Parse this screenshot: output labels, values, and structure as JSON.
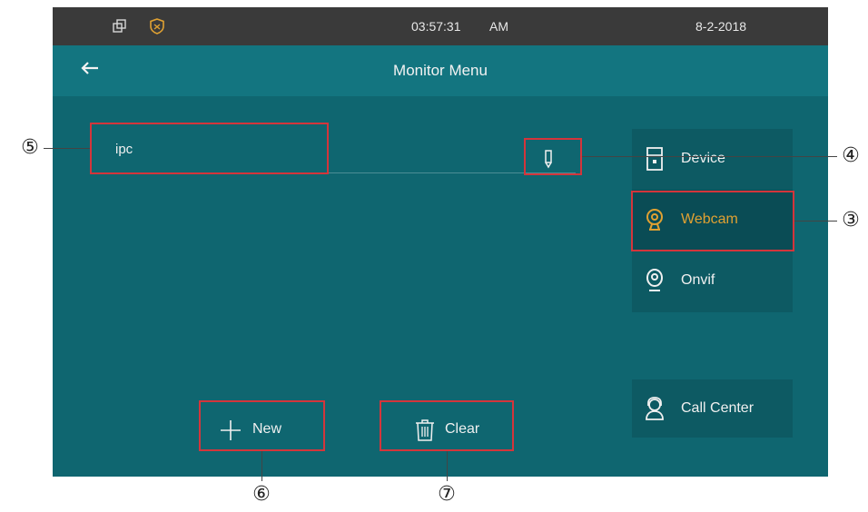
{
  "status_bar": {
    "time": "03:57:31",
    "meridiem": "AM",
    "date": "8-2-2018",
    "icons": [
      "windows-icon",
      "shield-icon"
    ]
  },
  "title_bar": {
    "back_icon": "arrow-left-icon",
    "title": "Monitor Menu"
  },
  "monitor_list": [
    {
      "label": "ipc"
    }
  ],
  "edit_icon": "pencil-icon",
  "side_menu": {
    "items": [
      {
        "label": "Device",
        "icon": "intercom-icon",
        "active": false
      },
      {
        "label": "Webcam",
        "icon": "webcam-icon",
        "active": true
      },
      {
        "label": "Onvif",
        "icon": "camera-icon",
        "active": false
      }
    ],
    "call_center": {
      "label": "Call Center",
      "icon": "call-center-icon"
    }
  },
  "actions": {
    "new": {
      "label": "New",
      "icon": "plus-icon"
    },
    "clear": {
      "label": "Clear",
      "icon": "trash-icon"
    }
  },
  "callouts": [
    "⑤",
    "④",
    "③",
    "⑥",
    "⑦"
  ],
  "colors": {
    "background": "#0f6670",
    "title_bar": "#137580",
    "status_bar": "#3a3a3a",
    "active_accent": "#e0a132",
    "highlight_box": "#d4353b"
  }
}
